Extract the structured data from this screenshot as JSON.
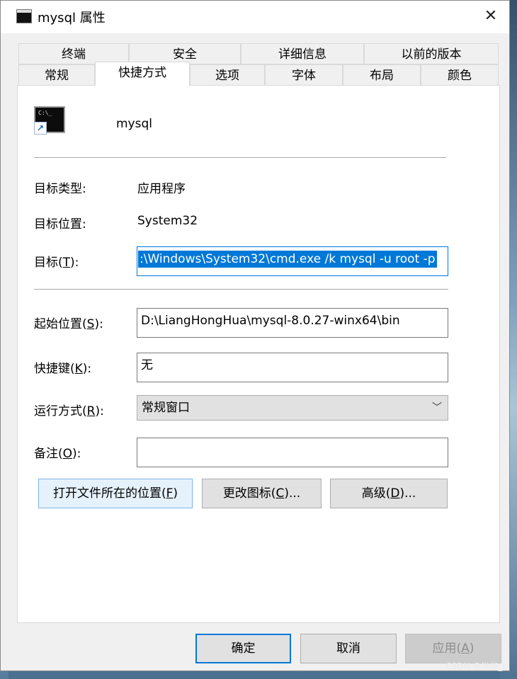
{
  "window": {
    "title": "mysql 属性",
    "close": "✕"
  },
  "tabs_back": [
    "终端",
    "安全",
    "详细信息",
    "以前的版本"
  ],
  "tabs_front": [
    "常规",
    "快捷方式",
    "选项",
    "字体",
    "布局",
    "颜色"
  ],
  "active_tab": "快捷方式",
  "header": {
    "app_name": "mysql"
  },
  "fields": {
    "target_type_label": "目标类型:",
    "target_type_value": "应用程序",
    "target_location_label": "目标位置:",
    "target_location_value": "System32",
    "target_label_prefix": "目标(",
    "target_label_key": "T",
    "target_label_suffix": "):",
    "target_value": ":\\Windows\\System32\\cmd.exe /k mysql -u root -p",
    "start_in_label_prefix": "起始位置(",
    "start_in_label_key": "S",
    "start_in_label_suffix": "):",
    "start_in_value": "D:\\LiangHongHua\\mysql-8.0.27-winx64\\bin",
    "hotkey_label_prefix": "快捷键(",
    "hotkey_label_key": "K",
    "hotkey_label_suffix": "):",
    "hotkey_value": "无",
    "run_label_prefix": "运行方式(",
    "run_label_key": "R",
    "run_label_suffix": "):",
    "run_value": "常规窗口",
    "comment_label_prefix": "备注(",
    "comment_label_key": "O",
    "comment_label_suffix": "):",
    "comment_value": ""
  },
  "actions": {
    "open_location_prefix": "打开文件所在的位置(",
    "open_location_key": "F",
    "open_location_suffix": ")",
    "change_icon_prefix": "更改图标(",
    "change_icon_key": "C",
    "change_icon_suffix": ")...",
    "advanced_prefix": "高级(",
    "advanced_key": "D",
    "advanced_suffix": ")..."
  },
  "footer": {
    "ok": "确定",
    "cancel": "取消",
    "apply_prefix": "应用(",
    "apply_key": "A",
    "apply_suffix": ")"
  },
  "watermark": "CSDN @洪华_L"
}
